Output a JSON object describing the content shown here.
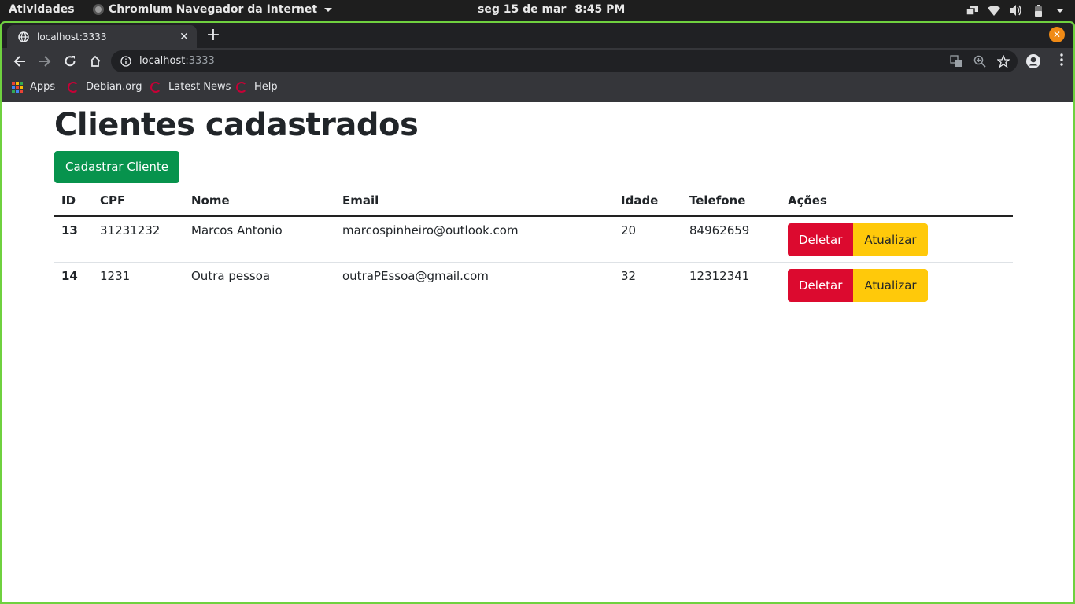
{
  "system": {
    "activities": "Atividades",
    "app_name": "Chromium Navegador da Internet",
    "date": "seg 15 de mar",
    "time": "8:45 PM"
  },
  "browser": {
    "tab_title": "localhost:3333",
    "url_host": "localhost",
    "url_port": ":3333",
    "bookmarks": [
      {
        "label": "Apps",
        "icon": "apps-grid-icon"
      },
      {
        "label": "Debian.org",
        "icon": "debian-icon"
      },
      {
        "label": "Latest News",
        "icon": "debian-icon"
      },
      {
        "label": "Help",
        "icon": "debian-icon"
      }
    ]
  },
  "page": {
    "heading": "Clientes cadastrados",
    "register_button": "Cadastrar Cliente",
    "columns": [
      "ID",
      "CPF",
      "Nome",
      "Email",
      "Idade",
      "Telefone",
      "Ações"
    ],
    "rows": [
      {
        "id": "13",
        "cpf": "31231232",
        "nome": "Marcos Antonio",
        "email": "marcospinheiro@outlook.com",
        "idade": "20",
        "telefone": "84962659"
      },
      {
        "id": "14",
        "cpf": "1231",
        "nome": "Outra pessoa",
        "email": "outraPEssoa@gmail.com",
        "idade": "32",
        "telefone": "12312341"
      }
    ],
    "delete_label": "Deletar",
    "update_label": "Atualizar"
  },
  "colors": {
    "success": "#07934d",
    "danger": "#dc0a2f",
    "warning": "#ffc90a",
    "window_border": "#6fd13f"
  }
}
